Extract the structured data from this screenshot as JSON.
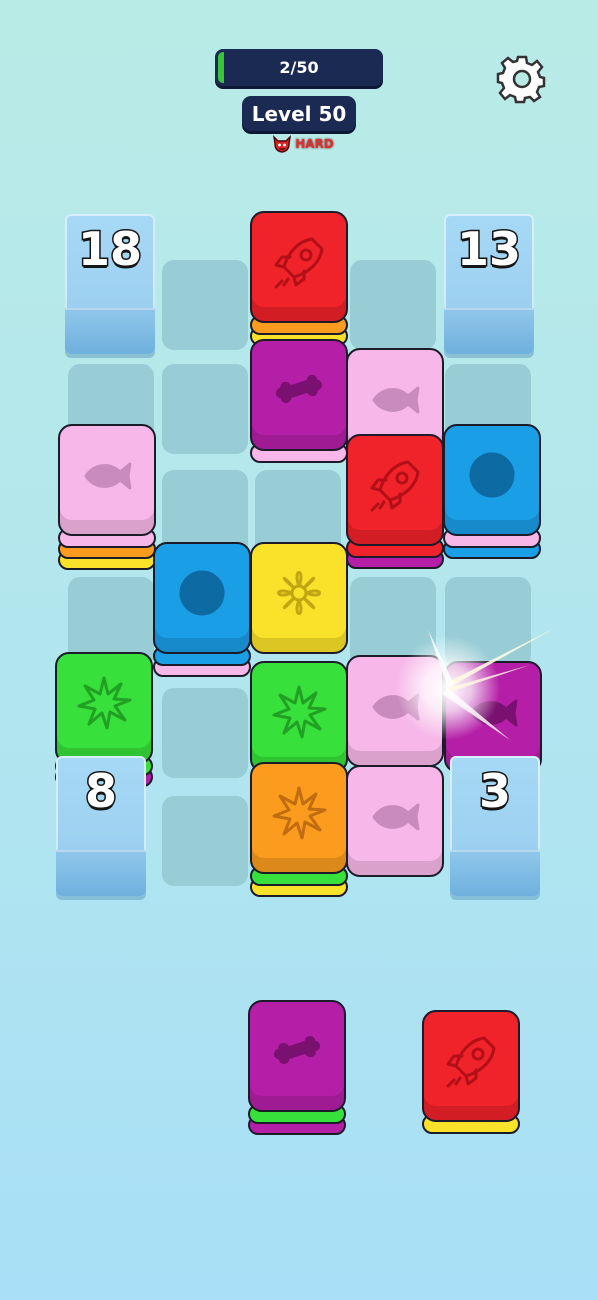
{
  "hud": {
    "progress_text": "2/50",
    "progress_fraction": 0.04,
    "level_label": "Level 50",
    "difficulty": "HARD",
    "settings_icon": "gear-icon",
    "difficulty_icon": "devil-icon"
  },
  "ice_blocks": [
    {
      "count": "18"
    },
    {
      "count": "13"
    },
    {
      "count": "8"
    },
    {
      "count": "3"
    }
  ],
  "colors": {
    "red": "#f0222a",
    "magenta": "#b51fa8",
    "pink": "#f7b8e9",
    "blue": "#1a9ee6",
    "yellow": "#fbe22a",
    "green": "#37e03a",
    "orange": "#fb9c1f"
  },
  "board_tiles": [
    {
      "icon": "rocket",
      "color": "red"
    },
    {
      "icon": "bone",
      "color": "magenta"
    },
    {
      "icon": "fish",
      "color": "pink"
    },
    {
      "icon": "fish",
      "color": "pink"
    },
    {
      "icon": "rocket",
      "color": "red"
    },
    {
      "icon": "ball",
      "color": "blue"
    },
    {
      "icon": "ball",
      "color": "blue"
    },
    {
      "icon": "flower",
      "color": "yellow"
    },
    {
      "icon": "burst",
      "color": "green"
    },
    {
      "icon": "burst",
      "color": "green"
    },
    {
      "icon": "fish",
      "color": "pink"
    },
    {
      "icon": "fish",
      "color": "magenta"
    },
    {
      "icon": "burst",
      "color": "orange"
    },
    {
      "icon": "fish",
      "color": "pink"
    }
  ],
  "tray_tiles": [
    {
      "icon": "bone",
      "color": "magenta"
    },
    {
      "icon": "rocket",
      "color": "red"
    }
  ]
}
